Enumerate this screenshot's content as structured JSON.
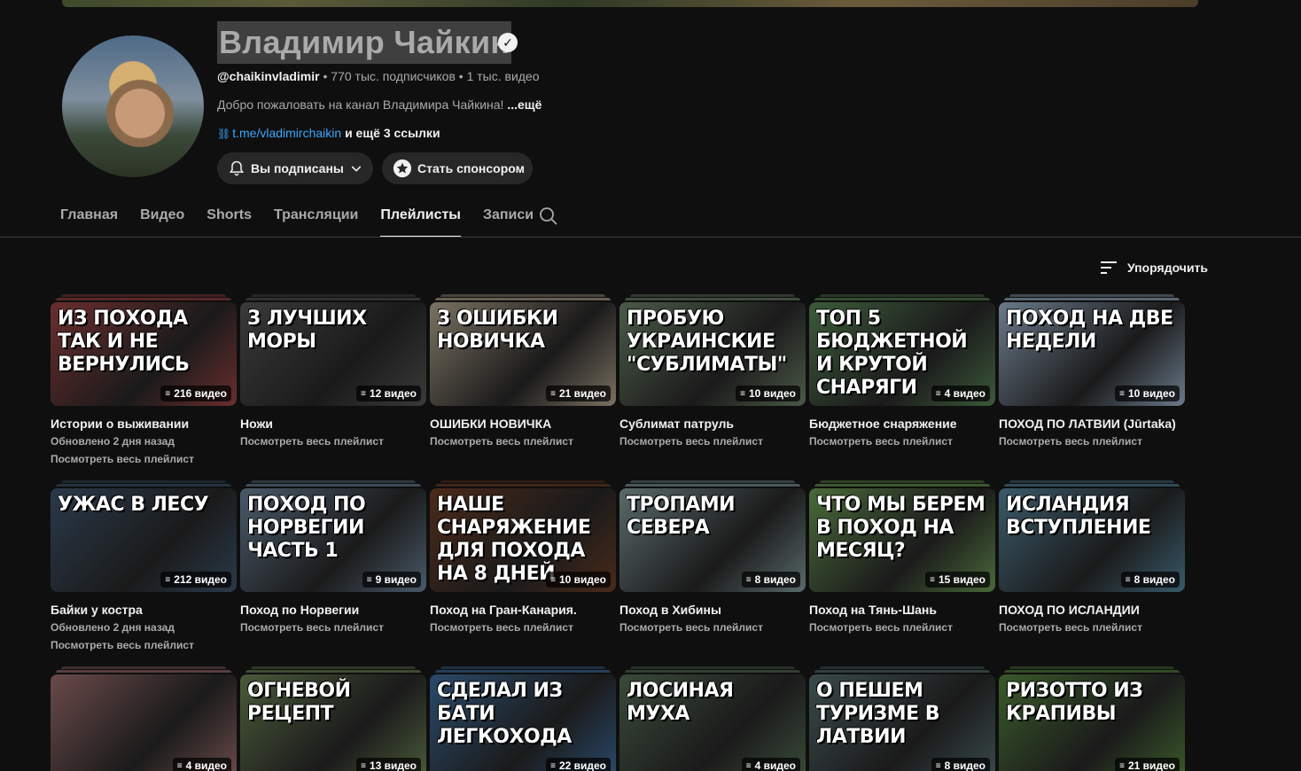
{
  "channel": {
    "name": "Владимир Чайкин",
    "handle": "@chaikinvladimir",
    "subscribers": "770 тыс. подписчиков",
    "videos": "1 тыс. видео",
    "separator": "•",
    "description": "Добро пожаловать на канал Владимира Чайкина!",
    "description_more": "...ещё",
    "link": "t.me/vladimirchaikin",
    "more_links": "и ещё 3 ссылки",
    "subscribed_label": "Вы подписаны",
    "sponsor_label": "Стать спонсором"
  },
  "tabs": [
    "Главная",
    "Видео",
    "Shorts",
    "Трансляции",
    "Плейлисты",
    "Записи"
  ],
  "active_tab": "Плейлисты",
  "sort_label": "Упорядочить",
  "playlists": [
    {
      "title": "Истории о выживании",
      "sub1": "Обновлено 2 дня назад",
      "sub2": "Посмотреть весь плейлист",
      "count": "216 видео",
      "thumb_text": "Из похода так и не вернулись",
      "color": "#6a2e2e"
    },
    {
      "title": "Ножи",
      "sub1": "Посмотреть весь плейлист",
      "sub2": "",
      "count": "12 видео",
      "thumb_text": "3 лучших моры",
      "color": "#3a3a3a"
    },
    {
      "title": "ОШИБКИ НОВИЧКА",
      "sub1": "Посмотреть весь плейлист",
      "sub2": "",
      "count": "21 видео",
      "thumb_text": "3 ошибки новичка",
      "color": "#7a7262"
    },
    {
      "title": "Сублимат патруль",
      "sub1": "Посмотреть весь плейлист",
      "sub2": "",
      "count": "10 видео",
      "thumb_text": "пробую украинские \"сублиматы\"",
      "color": "#4b5a48"
    },
    {
      "title": "Бюджетное снаряжение",
      "sub1": "Посмотреть весь плейлист",
      "sub2": "",
      "count": "4 видео",
      "thumb_text": "Топ 5 бюджетной и крутой снаряги",
      "color": "#3c5a3a"
    },
    {
      "title": "ПОХОД ПО ЛАТВИИ (Jūrtaka)",
      "sub1": "Посмотреть весь плейлист",
      "sub2": "",
      "count": "10 видео",
      "thumb_text": "поход на две недели",
      "color": "#6a7a8a"
    },
    {
      "title": "Байки у костра",
      "sub1": "Обновлено 2 дня назад",
      "sub2": "Посмотреть весь плейлист",
      "count": "212 видео",
      "thumb_text": "Ужас в лесу",
      "color": "#2a3a4a"
    },
    {
      "title": "Поход по Норвегии",
      "sub1": "Посмотреть весь плейлист",
      "sub2": "",
      "count": "9 видео",
      "thumb_text": "Поход по Норвегии часть 1",
      "color": "#4a5a6a"
    },
    {
      "title": "Поход на Гран-Канария.",
      "sub1": "Посмотреть весь плейлист",
      "sub2": "",
      "count": "10 видео",
      "thumb_text": "наше снаряжение для похода на 8 дней",
      "color": "#4a2a1a"
    },
    {
      "title": "Поход в Хибины",
      "sub1": "Посмотреть весь плейлист",
      "sub2": "",
      "count": "8 видео",
      "thumb_text": "Тропами севера",
      "color": "#5a6a6a"
    },
    {
      "title": "Поход на Тянь-Шань",
      "sub1": "Посмотреть весь плейлист",
      "sub2": "",
      "count": "15 видео",
      "thumb_text": "Что мы берем в поход на месяц?",
      "color": "#4a6a3a"
    },
    {
      "title": "ПОХОД ПО ИСЛАНДИИ",
      "sub1": "Посмотреть весь плейлист",
      "sub2": "",
      "count": "8 видео",
      "thumb_text": "Исландия вступление",
      "color": "#3a5a6a"
    },
    {
      "title": "",
      "sub1": "",
      "sub2": "",
      "count": "4 видео",
      "thumb_text": "",
      "color": "#6a4a4a"
    },
    {
      "title": "",
      "sub1": "",
      "sub2": "",
      "count": "13 видео",
      "thumb_text": "огневой рецепт",
      "color": "#4a5a3a"
    },
    {
      "title": "",
      "sub1": "",
      "sub2": "",
      "count": "22 видео",
      "thumb_text": "сделал из бати легкохода",
      "color": "#2a4a6a"
    },
    {
      "title": "",
      "sub1": "",
      "sub2": "",
      "count": "4 видео",
      "thumb_text": "Лосиная муха",
      "color": "#3a4a3a"
    },
    {
      "title": "",
      "sub1": "",
      "sub2": "",
      "count": "8 видео",
      "thumb_text": "о пешем туризме в Латвии",
      "color": "#3a4a4a"
    },
    {
      "title": "",
      "sub1": "",
      "sub2": "",
      "count": "21 видео",
      "thumb_text": "Ризотто из крапивы",
      "color": "#3a5a2a"
    }
  ]
}
